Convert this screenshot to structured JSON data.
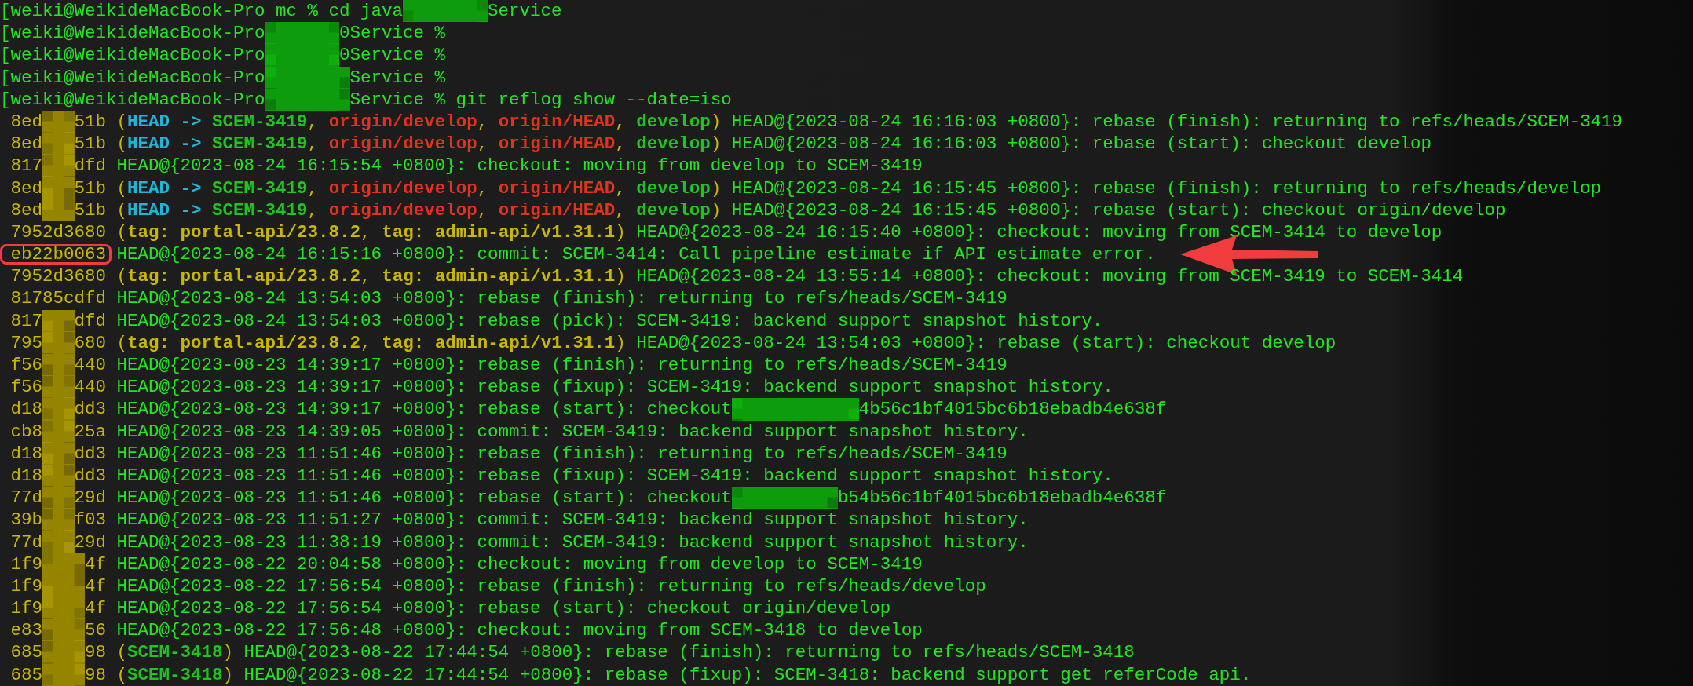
{
  "terminal": {
    "lines": [
      {
        "marked": false,
        "segments": [
          {
            "kind": "plain",
            "text": "[weiki@WeikideMacBook-Pro mc % cd java"
          },
          {
            "kind": "redacted",
            "color": "#0c9c0c"
          },
          {
            "kind": "plain",
            "text": "Service"
          }
        ]
      },
      {
        "marked": false,
        "segments": [
          {
            "kind": "plain",
            "text": "[weiki@WeikideMacBook-Pro"
          },
          {
            "kind": "redacted",
            "color": "#0c9c0c"
          },
          {
            "kind": "plain",
            "text": "0Service %"
          }
        ]
      },
      {
        "marked": false,
        "segments": [
          {
            "kind": "plain",
            "text": "[weiki@WeikideMacBook-Pro"
          },
          {
            "kind": "redacted",
            "color": "#0c9c0c"
          },
          {
            "kind": "plain",
            "text": "0Service %"
          }
        ]
      },
      {
        "marked": false,
        "segments": [
          {
            "kind": "plain",
            "text": "[weiki@WeikideMacBook-Pro"
          },
          {
            "kind": "redacted",
            "color": "#0c9c0c"
          },
          {
            "kind": "plain",
            "text": "Service %"
          }
        ]
      },
      {
        "marked": false,
        "segments": [
          {
            "kind": "plain",
            "text": "[weiki@WeikideMacBook-Pro"
          },
          {
            "kind": "redacted",
            "color": "#0c9c0c"
          },
          {
            "kind": "plain",
            "text": "Service % git reflog show --date=iso"
          }
        ]
      },
      {
        "marked": false,
        "segments": [
          {
            "kind": "hash",
            "text": " 8ed"
          },
          {
            "kind": "redacted",
            "color": "#948400"
          },
          {
            "kind": "hash",
            "text": "51b"
          },
          {
            "kind": "punct",
            "text": " ("
          },
          {
            "kind": "head",
            "text": "HEAD -> "
          },
          {
            "kind": "branch",
            "text": "SCEM-3419"
          },
          {
            "kind": "punct",
            "text": ", "
          },
          {
            "kind": "remote",
            "text": "origin/develop"
          },
          {
            "kind": "punct",
            "text": ", "
          },
          {
            "kind": "remote",
            "text": "origin/HEAD"
          },
          {
            "kind": "punct",
            "text": ", "
          },
          {
            "kind": "branch",
            "text": "develop"
          },
          {
            "kind": "punct",
            "text": ")"
          },
          {
            "kind": "plain",
            "text": " HEAD@{2023-08-24 16:16:03 +0800}: rebase (finish): returning to refs/heads/SCEM-3419"
          }
        ]
      },
      {
        "marked": false,
        "segments": [
          {
            "kind": "hash",
            "text": " 8ed"
          },
          {
            "kind": "redacted",
            "color": "#948400"
          },
          {
            "kind": "hash",
            "text": "51b"
          },
          {
            "kind": "punct",
            "text": " ("
          },
          {
            "kind": "head",
            "text": "HEAD -> "
          },
          {
            "kind": "branch",
            "text": "SCEM-3419"
          },
          {
            "kind": "punct",
            "text": ", "
          },
          {
            "kind": "remote",
            "text": "origin/develop"
          },
          {
            "kind": "punct",
            "text": ", "
          },
          {
            "kind": "remote",
            "text": "origin/HEAD"
          },
          {
            "kind": "punct",
            "text": ", "
          },
          {
            "kind": "branch",
            "text": "develop"
          },
          {
            "kind": "punct",
            "text": ")"
          },
          {
            "kind": "plain",
            "text": " HEAD@{2023-08-24 16:16:03 +0800}: rebase (start): checkout develop"
          }
        ]
      },
      {
        "marked": false,
        "segments": [
          {
            "kind": "hash",
            "text": " 817"
          },
          {
            "kind": "redacted",
            "color": "#948400"
          },
          {
            "kind": "hash",
            "text": "dfd"
          },
          {
            "kind": "plain",
            "text": " HEAD@{2023-08-24 16:15:54 +0800}: checkout: moving from develop to SCEM-3419"
          }
        ]
      },
      {
        "marked": false,
        "segments": [
          {
            "kind": "hash",
            "text": " 8ed"
          },
          {
            "kind": "redacted",
            "color": "#948400"
          },
          {
            "kind": "hash",
            "text": "51b"
          },
          {
            "kind": "punct",
            "text": " ("
          },
          {
            "kind": "head",
            "text": "HEAD -> "
          },
          {
            "kind": "branch",
            "text": "SCEM-3419"
          },
          {
            "kind": "punct",
            "text": ", "
          },
          {
            "kind": "remote",
            "text": "origin/develop"
          },
          {
            "kind": "punct",
            "text": ", "
          },
          {
            "kind": "remote",
            "text": "origin/HEAD"
          },
          {
            "kind": "punct",
            "text": ", "
          },
          {
            "kind": "branch",
            "text": "develop"
          },
          {
            "kind": "punct",
            "text": ")"
          },
          {
            "kind": "plain",
            "text": " HEAD@{2023-08-24 16:15:45 +0800}: rebase (finish): returning to refs/heads/develop"
          }
        ]
      },
      {
        "marked": false,
        "segments": [
          {
            "kind": "hash",
            "text": " 8ed"
          },
          {
            "kind": "redacted",
            "color": "#948400"
          },
          {
            "kind": "hash",
            "text": "51b"
          },
          {
            "kind": "punct",
            "text": " ("
          },
          {
            "kind": "head",
            "text": "HEAD -> "
          },
          {
            "kind": "branch",
            "text": "SCEM-3419"
          },
          {
            "kind": "punct",
            "text": ", "
          },
          {
            "kind": "remote",
            "text": "origin/develop"
          },
          {
            "kind": "punct",
            "text": ", "
          },
          {
            "kind": "remote",
            "text": "origin/HEAD"
          },
          {
            "kind": "punct",
            "text": ", "
          },
          {
            "kind": "branch",
            "text": "develop"
          },
          {
            "kind": "punct",
            "text": ")"
          },
          {
            "kind": "plain",
            "text": " HEAD@{2023-08-24 16:15:45 +0800}: rebase (start): checkout origin/develop"
          }
        ]
      },
      {
        "marked": false,
        "segments": [
          {
            "kind": "hash",
            "text": " 7952d3680"
          },
          {
            "kind": "punct",
            "text": " ("
          },
          {
            "kind": "tag",
            "text": "tag: portal-api/23.8.2"
          },
          {
            "kind": "punct",
            "text": ", "
          },
          {
            "kind": "tag",
            "text": "tag: admin-api/v1.31.1"
          },
          {
            "kind": "punct",
            "text": ")"
          },
          {
            "kind": "plain",
            "text": " HEAD@{2023-08-24 16:15:40 +0800}: checkout: moving from SCEM-3414 to develop"
          }
        ]
      },
      {
        "marked": true,
        "segments": [
          {
            "kind": "hash",
            "text": " eb22b0063"
          },
          {
            "kind": "plain",
            "text": " HEAD@{2023-08-24 16:15:16 +0800}: commit: SCEM-3414: Call pipeline estimate if API estimate error."
          }
        ]
      },
      {
        "marked": false,
        "segments": [
          {
            "kind": "hash",
            "text": " 7952d3680"
          },
          {
            "kind": "punct",
            "text": " ("
          },
          {
            "kind": "tag",
            "text": "tag: portal-api/23.8.2"
          },
          {
            "kind": "punct",
            "text": ", "
          },
          {
            "kind": "tag",
            "text": "tag: admin-api/v1.31.1"
          },
          {
            "kind": "punct",
            "text": ")"
          },
          {
            "kind": "plain",
            "text": " HEAD@{2023-08-24 13:55:14 +0800}: checkout: moving from SCEM-3419 to SCEM-3414"
          }
        ]
      },
      {
        "marked": false,
        "segments": [
          {
            "kind": "hash",
            "text": " 81785cdfd"
          },
          {
            "kind": "plain",
            "text": " HEAD@{2023-08-24 13:54:03 +0800}: rebase (finish): returning to refs/heads/SCEM-3419"
          }
        ]
      },
      {
        "marked": false,
        "segments": [
          {
            "kind": "hash",
            "text": " 817"
          },
          {
            "kind": "redacted",
            "color": "#948400"
          },
          {
            "kind": "hash",
            "text": "dfd"
          },
          {
            "kind": "plain",
            "text": " HEAD@{2023-08-24 13:54:03 +0800}: rebase (pick): SCEM-3419: backend support snapshot history."
          }
        ]
      },
      {
        "marked": false,
        "segments": [
          {
            "kind": "hash",
            "text": " 795"
          },
          {
            "kind": "redacted",
            "color": "#948400"
          },
          {
            "kind": "hash",
            "text": "680"
          },
          {
            "kind": "punct",
            "text": " ("
          },
          {
            "kind": "tag",
            "text": "tag: portal-api/23.8.2"
          },
          {
            "kind": "punct",
            "text": ", "
          },
          {
            "kind": "tag",
            "text": "tag: admin-api/v1.31.1"
          },
          {
            "kind": "punct",
            "text": ")"
          },
          {
            "kind": "plain",
            "text": " HEAD@{2023-08-24 13:54:03 +0800}: rebase (start): checkout develop"
          }
        ]
      },
      {
        "marked": false,
        "segments": [
          {
            "kind": "hash",
            "text": " f56"
          },
          {
            "kind": "redacted",
            "color": "#948400"
          },
          {
            "kind": "hash",
            "text": "440"
          },
          {
            "kind": "plain",
            "text": " HEAD@{2023-08-23 14:39:17 +0800}: rebase (finish): returning to refs/heads/SCEM-3419"
          }
        ]
      },
      {
        "marked": false,
        "segments": [
          {
            "kind": "hash",
            "text": " f56"
          },
          {
            "kind": "redacted",
            "color": "#948400"
          },
          {
            "kind": "hash",
            "text": "440"
          },
          {
            "kind": "plain",
            "text": " HEAD@{2023-08-23 14:39:17 +0800}: rebase (fixup): SCEM-3419: backend support snapshot history."
          }
        ]
      },
      {
        "marked": false,
        "segments": [
          {
            "kind": "hash",
            "text": " d18"
          },
          {
            "kind": "redacted",
            "color": "#948400"
          },
          {
            "kind": "hash",
            "text": "dd3"
          },
          {
            "kind": "plain",
            "text": " HEAD@{2023-08-23 14:39:17 +0800}: rebase (start): checkout"
          },
          {
            "kind": "redacted",
            "color": "#0c9c0c"
          },
          {
            "kind": "plain",
            "text": "4b56c1bf4015bc6b18ebadb4e638f"
          }
        ]
      },
      {
        "marked": false,
        "segments": [
          {
            "kind": "hash",
            "text": " cb8"
          },
          {
            "kind": "redacted",
            "color": "#948400"
          },
          {
            "kind": "hash",
            "text": "25a"
          },
          {
            "kind": "plain",
            "text": " HEAD@{2023-08-23 14:39:05 +0800}: commit: SCEM-3419: backend support snapshot history."
          }
        ]
      },
      {
        "marked": false,
        "segments": [
          {
            "kind": "hash",
            "text": " d18"
          },
          {
            "kind": "redacted",
            "color": "#948400"
          },
          {
            "kind": "hash",
            "text": "dd3"
          },
          {
            "kind": "plain",
            "text": " HEAD@{2023-08-23 11:51:46 +0800}: rebase (finish): returning to refs/heads/SCEM-3419"
          }
        ]
      },
      {
        "marked": false,
        "segments": [
          {
            "kind": "hash",
            "text": " d18"
          },
          {
            "kind": "redacted",
            "color": "#948400"
          },
          {
            "kind": "hash",
            "text": "dd3"
          },
          {
            "kind": "plain",
            "text": " HEAD@{2023-08-23 11:51:46 +0800}: rebase (fixup): SCEM-3419: backend support snapshot history."
          }
        ]
      },
      {
        "marked": false,
        "segments": [
          {
            "kind": "hash",
            "text": " 77d"
          },
          {
            "kind": "redacted",
            "color": "#948400"
          },
          {
            "kind": "hash",
            "text": "29d"
          },
          {
            "kind": "plain",
            "text": " HEAD@{2023-08-23 11:51:46 +0800}: rebase (start): checkout"
          },
          {
            "kind": "redacted",
            "color": "#0c9c0c"
          },
          {
            "kind": "plain",
            "text": "b54b56c1bf4015bc6b18ebadb4e638f"
          }
        ]
      },
      {
        "marked": false,
        "segments": [
          {
            "kind": "hash",
            "text": " 39b"
          },
          {
            "kind": "redacted",
            "color": "#948400"
          },
          {
            "kind": "hash",
            "text": "f03"
          },
          {
            "kind": "plain",
            "text": " HEAD@{2023-08-23 11:51:27 +0800}: commit: SCEM-3419: backend support snapshot history."
          }
        ]
      },
      {
        "marked": false,
        "segments": [
          {
            "kind": "hash",
            "text": " 77d"
          },
          {
            "kind": "redacted",
            "color": "#948400"
          },
          {
            "kind": "hash",
            "text": "29d"
          },
          {
            "kind": "plain",
            "text": " HEAD@{2023-08-23 11:38:19 +0800}: commit: SCEM-3419: backend support snapshot history."
          }
        ]
      },
      {
        "marked": false,
        "segments": [
          {
            "kind": "hash",
            "text": " 1f9"
          },
          {
            "kind": "redacted",
            "color": "#948400"
          },
          {
            "kind": "hash",
            "text": "4f"
          },
          {
            "kind": "plain",
            "text": " HEAD@{2023-08-22 20:04:58 +0800}: checkout: moving from develop to SCEM-3419"
          }
        ]
      },
      {
        "marked": false,
        "segments": [
          {
            "kind": "hash",
            "text": " 1f9"
          },
          {
            "kind": "redacted",
            "color": "#948400"
          },
          {
            "kind": "hash",
            "text": "4f"
          },
          {
            "kind": "plain",
            "text": " HEAD@{2023-08-22 17:56:54 +0800}: rebase (finish): returning to refs/heads/develop"
          }
        ]
      },
      {
        "marked": false,
        "segments": [
          {
            "kind": "hash",
            "text": " 1f9"
          },
          {
            "kind": "redacted",
            "color": "#948400"
          },
          {
            "kind": "hash",
            "text": "4f"
          },
          {
            "kind": "plain",
            "text": " HEAD@{2023-08-22 17:56:54 +0800}: rebase (start): checkout origin/develop"
          }
        ]
      },
      {
        "marked": false,
        "segments": [
          {
            "kind": "hash",
            "text": " e83"
          },
          {
            "kind": "redacted",
            "color": "#948400"
          },
          {
            "kind": "hash",
            "text": "56"
          },
          {
            "kind": "plain",
            "text": " HEAD@{2023-08-22 17:56:48 +0800}: checkout: moving from SCEM-3418 to develop"
          }
        ]
      },
      {
        "marked": false,
        "segments": [
          {
            "kind": "hash",
            "text": " 685"
          },
          {
            "kind": "redacted",
            "color": "#948400"
          },
          {
            "kind": "hash",
            "text": "98"
          },
          {
            "kind": "punct",
            "text": " ("
          },
          {
            "kind": "branch",
            "text": "SCEM-3418"
          },
          {
            "kind": "punct",
            "text": ")"
          },
          {
            "kind": "plain",
            "text": " HEAD@{2023-08-22 17:44:54 +0800}: rebase (finish): returning to refs/heads/SCEM-3418"
          }
        ]
      },
      {
        "marked": false,
        "segments": [
          {
            "kind": "hash",
            "text": " 685"
          },
          {
            "kind": "redacted",
            "color": "#948400"
          },
          {
            "kind": "hash",
            "text": "98"
          },
          {
            "kind": "punct",
            "text": " ("
          },
          {
            "kind": "branch",
            "text": "SCEM-3418"
          },
          {
            "kind": "punct",
            "text": ")"
          },
          {
            "kind": "plain",
            "text": " HEAD@{2023-08-22 17:44:54 +0800}: rebase (fixup): SCEM-3418: backend support get referCode api."
          }
        ]
      }
    ]
  }
}
